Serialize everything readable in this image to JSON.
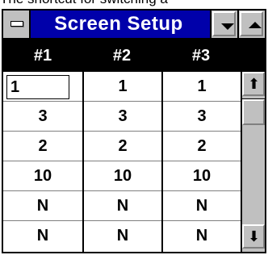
{
  "caption": {
    "text": "The shortcut for switching a"
  },
  "window": {
    "title": "Screen Setup",
    "controls": [
      "system-menu-icon",
      "minimize-icon",
      "maximize-icon"
    ]
  },
  "table": {
    "headers": [
      "#1",
      "#2",
      "#3"
    ],
    "rows": [
      [
        "1",
        "1",
        "1"
      ],
      [
        "3",
        "3",
        "3"
      ],
      [
        "2",
        "2",
        "2"
      ],
      [
        "10",
        "10",
        "10"
      ],
      [
        "N",
        "N",
        "N"
      ],
      [
        "N",
        "N",
        "N"
      ]
    ],
    "editing_cell_value": "1"
  },
  "scrollbar": {
    "up_glyph": "⬆",
    "down_glyph": "⬇"
  },
  "colors": {
    "title_bar": "#0000aa",
    "window_face": "#c0c0c0",
    "header_bg": "#000000"
  }
}
